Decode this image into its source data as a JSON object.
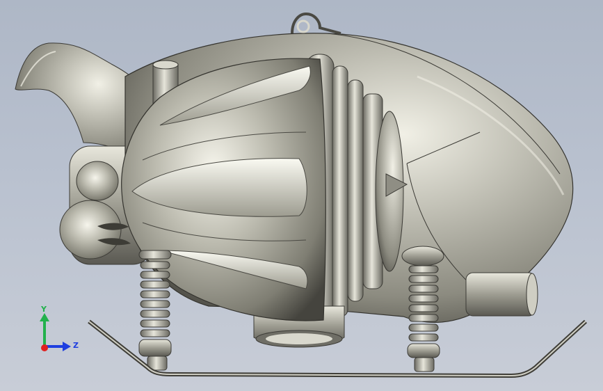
{
  "viewport": {
    "background_top": "#aeb7c6",
    "background_bottom": "#c8cdd7",
    "model_color": "#a9a89c"
  },
  "triad": {
    "y_label": "Y",
    "z_label": "Z",
    "y_color": "#22b14c",
    "z_color": "#1f3fe0",
    "x_color": "#e02020"
  }
}
